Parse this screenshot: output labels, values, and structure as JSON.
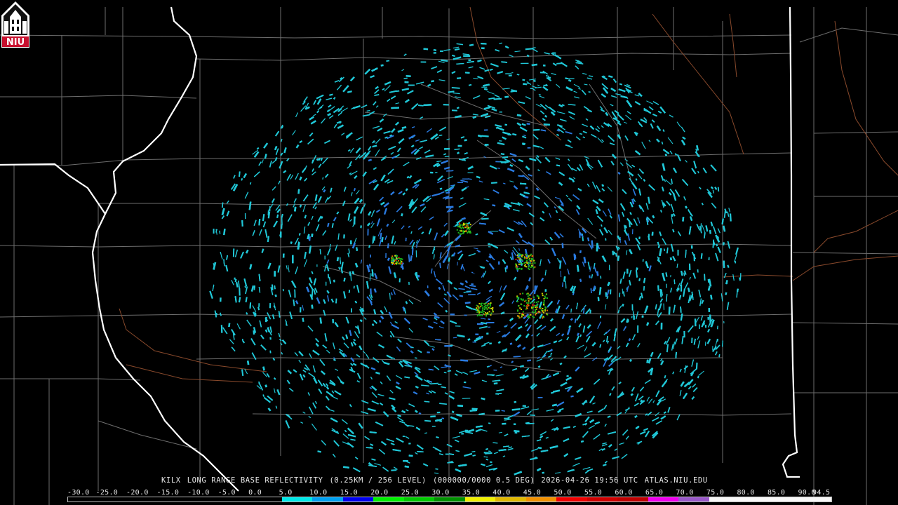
{
  "product": {
    "station": "KILX",
    "product_name": "LONG RANGE BASE REFLECTIVITY",
    "resolution": "(0.25KM / 256 LEVEL)",
    "volume": "(000000/0000 0.5 DEG)",
    "timestamp": "2026-04-26 19:56 UTC",
    "source": "ATLAS.NIU.EDU"
  },
  "logo": {
    "text": "NIU",
    "icon": "niu-tower-logo",
    "color": "#c8102e"
  },
  "radar": {
    "site_marker_icon": "radar-site-dot",
    "center_color": "#000000"
  },
  "colors": {
    "background": "#000000",
    "county_lines": "#6e6e6e",
    "state_lines": "#ffffff",
    "rivers": "#8a4a2c",
    "echo_light": "#20c8d8",
    "echo_medium": "#2a7ae0",
    "echo_heavy": "#1ab81a"
  },
  "color_scale": {
    "labels": [
      "-30.0",
      "-25.0",
      "-20.0",
      "-15.0",
      "-10.0",
      "-5.0",
      "0.0",
      "5.0",
      "10.0",
      "15.0",
      "20.0",
      "25.0",
      "30.0",
      "35.0",
      "40.0",
      "45.0",
      "50.0",
      "55.0",
      "60.0",
      "65.0",
      "70.0",
      "75.0",
      "80.0",
      "85.0",
      "90.0",
      "94.5"
    ],
    "colors": [
      "#000000",
      "#000000",
      "#000000",
      "#000000",
      "#000000",
      "#000000",
      "#000000",
      "#00e8e8",
      "#00a0f0",
      "#0000f0",
      "#00f000",
      "#00c800",
      "#009000",
      "#f0f000",
      "#e0b800",
      "#f09000",
      "#f00000",
      "#d00000",
      "#c00000",
      "#f000f0",
      "#9858c8",
      "#f8f8f8",
      "#f8f8f8",
      "#f8f8f8",
      "#f8f8f8"
    ]
  }
}
